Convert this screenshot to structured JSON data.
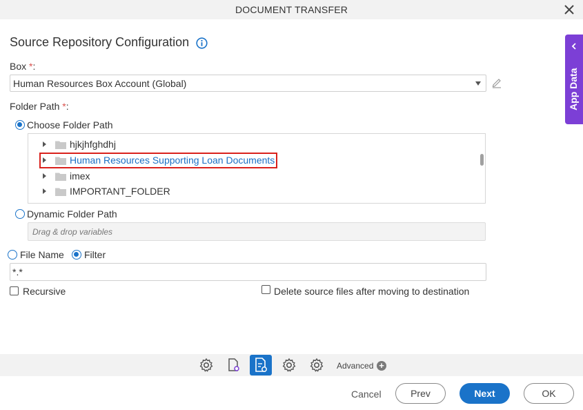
{
  "dialog": {
    "title": "DOCUMENT TRANSFER"
  },
  "section": {
    "title": "Source Repository Configuration"
  },
  "box": {
    "label": "Box",
    "required_mark": "*",
    "label_suffix": ":",
    "selected": "Human Resources Box Account (Global)"
  },
  "folder_path": {
    "label": "Folder Path",
    "required_mark": "*",
    "label_suffix": ":",
    "choose_option": "Choose Folder Path",
    "dynamic_option": "Dynamic Folder Path",
    "dynamic_placeholder": "Drag & drop variables",
    "selected_mode": "choose",
    "tree_items": [
      {
        "name": "hjkjhfghdhj",
        "selected": false
      },
      {
        "name": "Human Resources Supporting Loan Documents",
        "selected": true
      },
      {
        "name": "imex",
        "selected": false
      },
      {
        "name": "IMPORTANT_FOLDER",
        "selected": false
      }
    ]
  },
  "file_selection": {
    "file_name_option": "File Name",
    "filter_option": "Filter",
    "selected_mode": "filter",
    "filter_value": "*.*"
  },
  "options": {
    "recursive_label": "Recursive",
    "recursive_checked": false,
    "delete_label": "Delete source files after moving to destination",
    "delete_checked": false
  },
  "side_panel": {
    "label": "App Data"
  },
  "toolbar": {
    "icons": [
      "gear-icon",
      "document-settings-icon",
      "file-settings-icon",
      "gear-icon",
      "advanced-gear-icon"
    ],
    "active_index": 2,
    "advanced_label": "Advanced"
  },
  "footer": {
    "cancel_label": "Cancel",
    "prev_label": "Prev",
    "next_label": "Next",
    "ok_label": "OK"
  },
  "colors": {
    "accent": "#1a73c9",
    "side_panel": "#7c3fd6",
    "required": "#d9534f",
    "highlight_border": "#d9201b"
  }
}
